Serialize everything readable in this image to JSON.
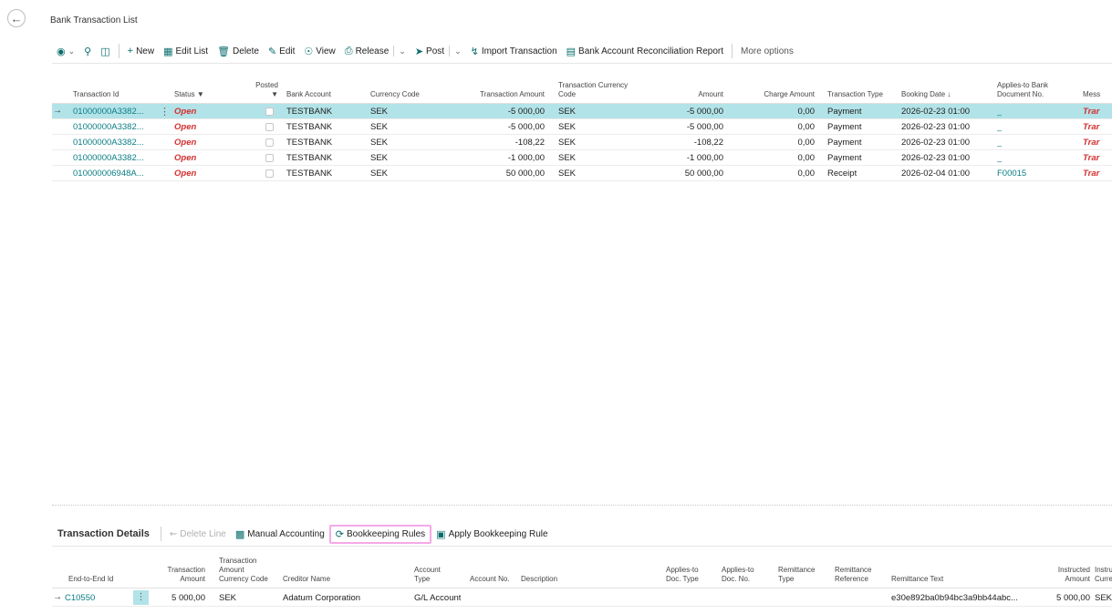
{
  "page": {
    "title": "Bank Transaction List",
    "back_icon": "arrow-left-icon"
  },
  "toolbar": {
    "new": "New",
    "edit_list": "Edit List",
    "delete": "Delete",
    "edit": "Edit",
    "view": "View",
    "release": "Release",
    "post": "Post",
    "import_transaction": "Import Transaction",
    "reconciliation_report": "Bank Account Reconciliation Report",
    "more_options": "More options"
  },
  "grid": {
    "headers": {
      "transaction_id": "Transaction Id",
      "status": "Status",
      "posted": "Posted",
      "bank_account": "Bank Account",
      "currency_code": "Currency Code",
      "transaction_amount": "Transaction Amount",
      "transaction_currency_code_1": "Transaction Currency",
      "transaction_currency_code_2": "Code",
      "amount": "Amount",
      "charge_amount": "Charge Amount",
      "transaction_type": "Transaction Type",
      "booking_date": "Booking Date",
      "applies_to_1": "Applies-to Bank",
      "applies_to_2": "Document No.",
      "message": "Mess"
    },
    "rows": [
      {
        "id": "01000000A3382...",
        "status": "Open",
        "bank": "TESTBANK",
        "currency": "SEK",
        "trans_amount": "-5 000,00",
        "trans_currency": "SEK",
        "amount": "-5 000,00",
        "charge": "0,00",
        "type": "Payment",
        "booking": "2026-02-23 01:00",
        "applies": "_",
        "message": "Trar"
      },
      {
        "id": "01000000A3382...",
        "status": "Open",
        "bank": "TESTBANK",
        "currency": "SEK",
        "trans_amount": "-5 000,00",
        "trans_currency": "SEK",
        "amount": "-5 000,00",
        "charge": "0,00",
        "type": "Payment",
        "booking": "2026-02-23 01:00",
        "applies": "_",
        "message": "Trar"
      },
      {
        "id": "01000000A3382...",
        "status": "Open",
        "bank": "TESTBANK",
        "currency": "SEK",
        "trans_amount": "-108,22",
        "trans_currency": "SEK",
        "amount": "-108,22",
        "charge": "0,00",
        "type": "Payment",
        "booking": "2026-02-23 01:00",
        "applies": "_",
        "message": "Trar"
      },
      {
        "id": "01000000A3382...",
        "status": "Open",
        "bank": "TESTBANK",
        "currency": "SEK",
        "trans_amount": "-1 000,00",
        "trans_currency": "SEK",
        "amount": "-1 000,00",
        "charge": "0,00",
        "type": "Payment",
        "booking": "2026-02-23 01:00",
        "applies": "_",
        "message": "Trar"
      },
      {
        "id": "010000006948A...",
        "status": "Open",
        "bank": "TESTBANK",
        "currency": "SEK",
        "trans_amount": "50 000,00",
        "trans_currency": "SEK",
        "amount": "50 000,00",
        "charge": "0,00",
        "type": "Receipt",
        "booking": "2026-02-04 01:00",
        "applies": "F00015",
        "message": "Trar"
      }
    ]
  },
  "details": {
    "title": "Transaction Details",
    "delete_line": "Delete Line",
    "manual_accounting": "Manual Accounting",
    "bookkeeping_rules": "Bookkeeping Rules",
    "apply_bookkeeping_rule": "Apply Bookkeeping Rule",
    "headers": {
      "end_to_end": "End-to-End Id",
      "trans_amount_1": "Transaction",
      "trans_amount_2": "Amount",
      "tacc_1": "Transaction",
      "tacc_2": "Amount",
      "tacc_3": "Currency Code",
      "creditor": "Creditor Name",
      "acc_type_1": "Account",
      "acc_type_2": "Type",
      "acc_no": "Account No.",
      "description": "Description",
      "adt_1": "Applies-to",
      "adt_2": "Doc. Type",
      "adn_1": "Applies-to",
      "adn_2": "Doc. No.",
      "rt_1": "Remittance",
      "rt_2": "Type",
      "rr_1": "Remittance",
      "rr_2": "Reference",
      "remittance_text": "Remittance Text",
      "ia_1": "Instructed",
      "ia_2": "Amount",
      "ic_1": "Instruc",
      "ic_2": "Curren"
    },
    "row": {
      "end_to_end": "C10550",
      "trans_amount": "5 000,00",
      "currency": "SEK",
      "creditor": "Adatum Corporation",
      "account_type": "G/L Account",
      "remittance_text": "e30e892ba0b94bc3a9bb44abc...",
      "instructed_amount": "5 000,00",
      "instructed_currency": "SEK"
    }
  }
}
